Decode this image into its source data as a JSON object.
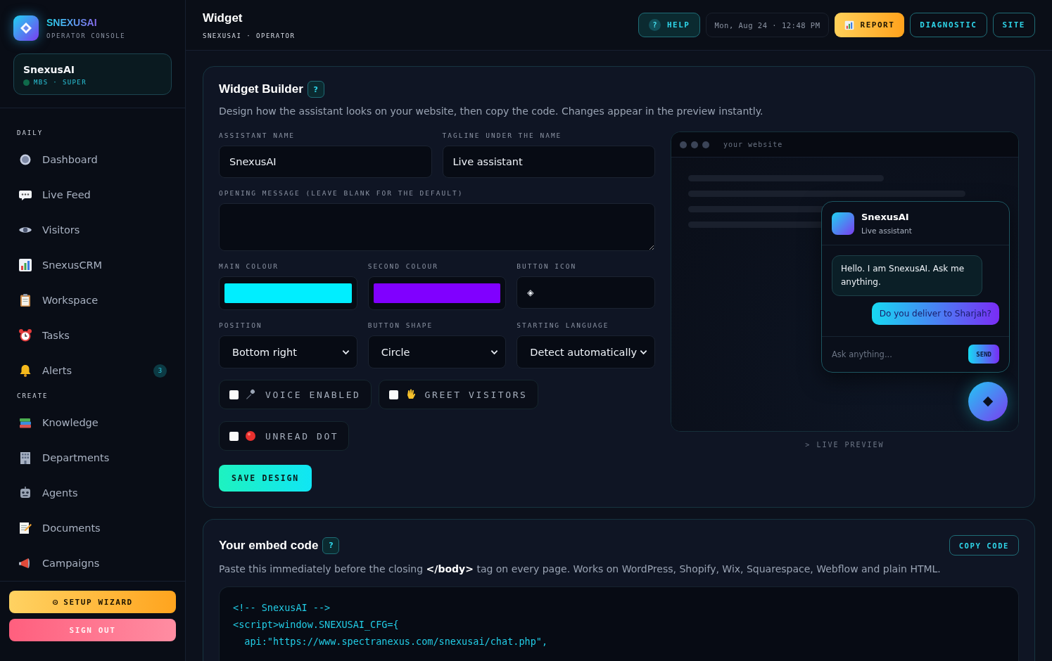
{
  "sidebar": {
    "brand": {
      "name": "SNEXUSAI",
      "subtitle": "OPERATOR CONSOLE"
    },
    "account": {
      "name": "SnexusAI",
      "role": "MBS · SUPER"
    },
    "sections": [
      {
        "title": "DAILY",
        "items": [
          {
            "label": "Dashboard",
            "selected": false
          },
          {
            "label": "Live Feed",
            "selected": false
          },
          {
            "label": "Visitors",
            "selected": false
          },
          {
            "label": "SnexusCRM",
            "selected": false
          },
          {
            "label": "Workspace",
            "selected": false
          },
          {
            "label": "Tasks",
            "selected": false
          },
          {
            "label": "Alerts",
            "badge": "3",
            "selected": false
          }
        ]
      },
      {
        "title": "CREATE",
        "items": [
          {
            "label": "Knowledge",
            "selected": false
          },
          {
            "label": "Departments",
            "selected": false
          },
          {
            "label": "Agents",
            "selected": false
          },
          {
            "label": "Documents",
            "selected": false
          },
          {
            "label": "Campaigns",
            "selected": false
          }
        ]
      }
    ],
    "footer_buttons": [
      {
        "label": "SETUP WIZARD",
        "kind": "wizard"
      },
      {
        "label": "SIGN OUT",
        "kind": "danger"
      }
    ]
  },
  "header": {
    "title": "Widget",
    "subtitle": "SNEXUSAI · OPERATOR",
    "help": "HELP",
    "help_mark": "?",
    "datetime": "Mon, Aug 24 · 12:48 PM",
    "buttons": [
      {
        "label": "REPORT",
        "kind": "accent"
      },
      {
        "label": "DIAGNOSTIC",
        "kind": "outline"
      },
      {
        "label": "SITE",
        "kind": "outline"
      }
    ]
  },
  "builder": {
    "title": "Widget Builder",
    "help_badge": "?",
    "description": "Design how the assistant looks on your website, then copy the code. Changes appear in the preview instantly.",
    "assistant_name": {
      "label": "ASSISTANT NAME",
      "value": "SnexusAI"
    },
    "tagline": {
      "label": "TAGLINE UNDER THE NAME",
      "value": "Live assistant"
    },
    "opening_message": {
      "label": "OPENING MESSAGE (LEAVE BLANK FOR THE DEFAULT)"
    },
    "main_colour": {
      "label": "MAIN COLOUR",
      "color": "#00eeff"
    },
    "second_colour": {
      "label": "SECOND COLOUR",
      "color": "#8000ff"
    },
    "button_icon": {
      "label": "BUTTON ICON",
      "value": "◈"
    },
    "selects": [
      {
        "label": "POSITION",
        "value": "Bottom right"
      },
      {
        "label": "BUTTON SHAPE",
        "value": "Circle"
      },
      {
        "label": "STARTING LANGUAGE",
        "value": "Detect automatically"
      }
    ],
    "options": [
      {
        "label": "VOICE ENABLED",
        "kind": "mic",
        "checked": false
      },
      {
        "label": "GREET VISITORS",
        "kind": "wave",
        "checked": false
      },
      {
        "label": "UNREAD DOT",
        "kind": "dot",
        "checked": false
      }
    ],
    "save_button": "SAVE DESIGN"
  },
  "preview": {
    "address": "your website",
    "widget": {
      "name": "SnexusAI",
      "tagline": "Live assistant",
      "messages": [
        {
          "kind": "bot",
          "text": "Hello. I am SnexusAI. Ask me anything."
        },
        {
          "kind": "user",
          "text": "Do you deliver to Sharjah?"
        }
      ],
      "input_placeholder": "Ask anything...",
      "send": "SEND"
    },
    "caption": "> LIVE PREVIEW"
  },
  "embed": {
    "title": "Your embed code",
    "help_badge": "?",
    "copy_button": "COPY CODE",
    "description": "Paste this immediately before the closing **</body>** tag on every page. Works on WordPress, Shopify, Wix, Squarespace, Webflow and plain HTML.",
    "code_lines": [
      "<!-- SnexusAI -->",
      "<script>window.SNEXUSAI_CFG={",
      "  api:\"https://www.spectranexus.com/snexusai/chat.php\","
    ]
  }
}
